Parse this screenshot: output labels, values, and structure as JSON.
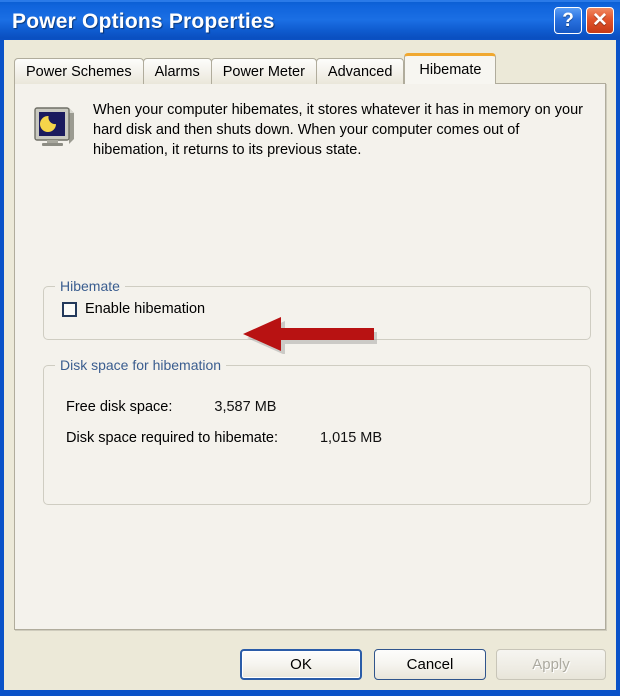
{
  "window": {
    "title": "Power Options Properties",
    "help_button": "?",
    "close_button": "✕"
  },
  "tabs": [
    {
      "label": "Power Schemes",
      "active": false
    },
    {
      "label": "Alarms",
      "active": false
    },
    {
      "label": "Power Meter",
      "active": false
    },
    {
      "label": "Advanced",
      "active": false
    },
    {
      "label": "Hibemate",
      "active": true
    }
  ],
  "info": {
    "icon": "monitor-moon-icon",
    "text": "When your computer hibemates, it stores whatever it has in memory on your hard disk and then shuts down. When your computer comes out of hibemation, it returns to its previous state."
  },
  "hibernate_group": {
    "legend": "Hibemate",
    "checkbox": {
      "label": "Enable hibemation",
      "checked": false
    }
  },
  "disk_group": {
    "legend": "Disk space for hibemation",
    "rows": [
      {
        "label": "Free disk space:",
        "value": "3,587 MB"
      },
      {
        "label": "Disk space required to hibemate:",
        "value": "1,015 MB"
      }
    ]
  },
  "annotation": {
    "arrow": "red-left-arrow",
    "color": "#b81212"
  },
  "footer": {
    "ok": "OK",
    "cancel": "Cancel",
    "apply": "Apply"
  },
  "colors": {
    "titlebar_blue": "#0b5fd4",
    "accent_tab": "#f0a830",
    "group_label": "#3a5d8f",
    "panel_bg": "#f4f2ec",
    "dialog_bg": "#ece9d8",
    "arrow_red": "#b81212"
  }
}
